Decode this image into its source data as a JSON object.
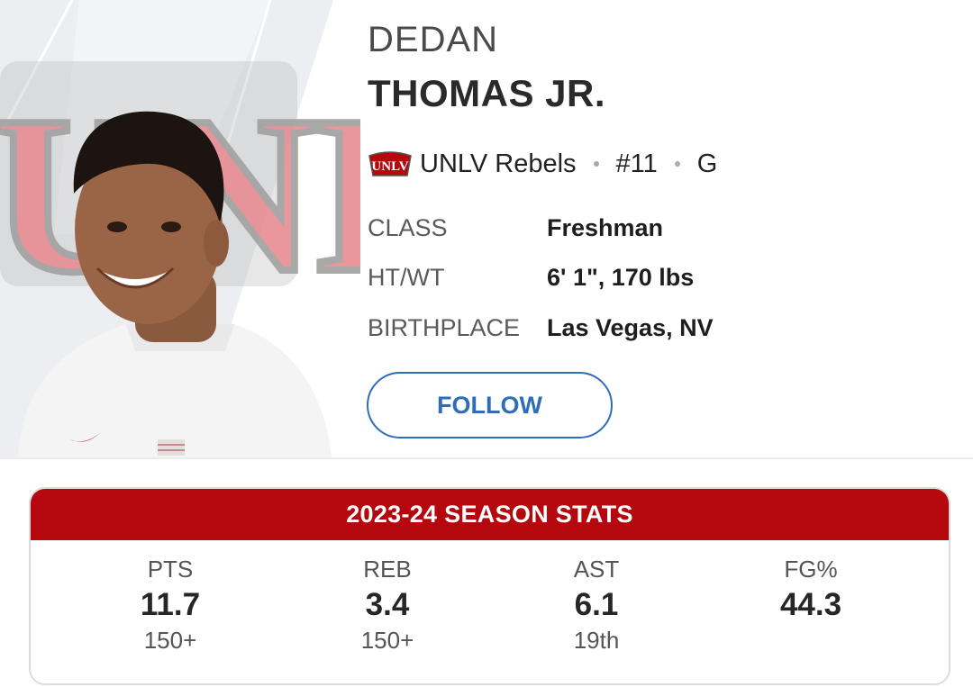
{
  "player": {
    "first_name": "DEDAN",
    "last_name": "THOMAS JR.",
    "team": "UNLV Rebels",
    "number": "#11",
    "position": "G"
  },
  "bio": [
    {
      "label": "CLASS",
      "value": "Freshman"
    },
    {
      "label": "HT/WT",
      "value": "6' 1\", 170 lbs"
    },
    {
      "label": "BIRTHPLACE",
      "value": "Las Vegas, NV"
    }
  ],
  "follow_label": "FOLLOW",
  "stats": {
    "title": "2023-24 SEASON STATS",
    "items": [
      {
        "label": "PTS",
        "value": "11.7",
        "rank": "150+"
      },
      {
        "label": "REB",
        "value": "3.4",
        "rank": "150+"
      },
      {
        "label": "AST",
        "value": "6.1",
        "rank": "19th"
      },
      {
        "label": "FG%",
        "value": "44.3",
        "rank": ""
      }
    ]
  },
  "logo_text": "UNLV",
  "colors": {
    "accent_red": "#b5080e",
    "follow_blue": "#2f6db8"
  }
}
